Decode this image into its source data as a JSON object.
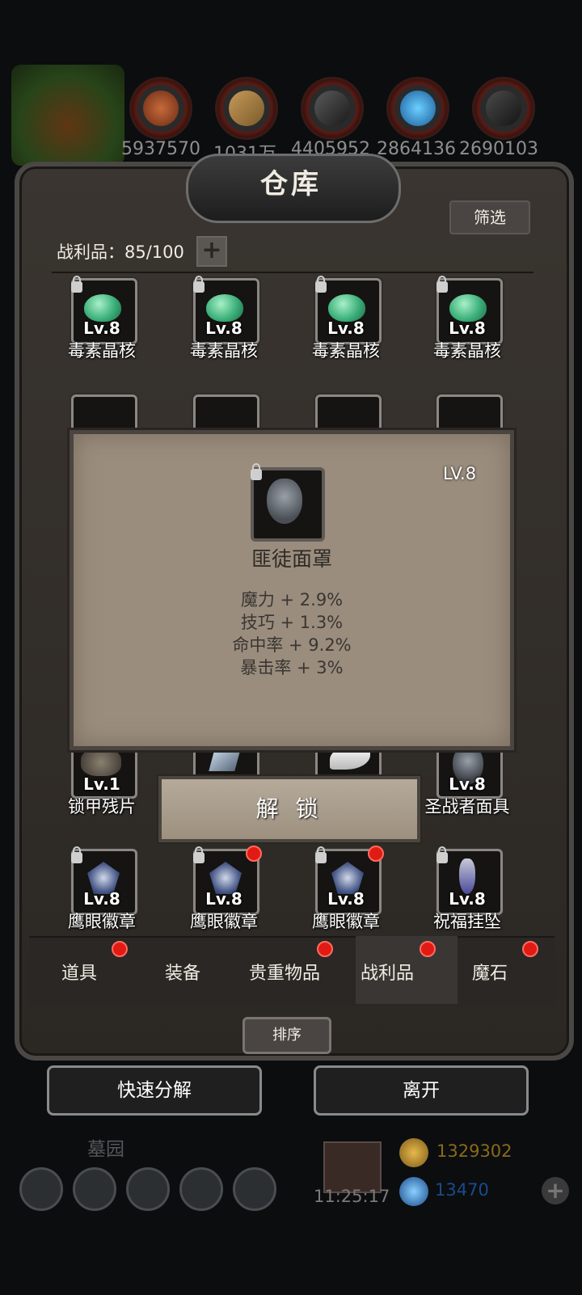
{
  "resources": [
    {
      "icon": "meat-icon",
      "value": "5937570"
    },
    {
      "icon": "wood-icon",
      "value": "1031万"
    },
    {
      "icon": "iron-icon",
      "value": "4405952"
    },
    {
      "icon": "crystal-icon",
      "value": "2864136"
    },
    {
      "icon": "stone-icon",
      "value": "2690103"
    }
  ],
  "warehouse": {
    "title": "仓库",
    "filter_label": "筛选",
    "counter_label": "战利品：85/100",
    "plus": "+"
  },
  "rows": [
    [
      {
        "name": "毒素晶核",
        "lv": "Lv.8",
        "icon": "green-gem-icon",
        "locked": true,
        "alert": false
      },
      {
        "name": "毒素晶核",
        "lv": "Lv.8",
        "icon": "green-gem-icon",
        "locked": true,
        "alert": false
      },
      {
        "name": "毒素晶核",
        "lv": "Lv.8",
        "icon": "green-gem-icon",
        "locked": true,
        "alert": false
      },
      {
        "name": "毒素晶核",
        "lv": "Lv.8",
        "icon": "green-gem-icon",
        "locked": true,
        "alert": false
      }
    ],
    [
      {
        "name": "锁甲残片",
        "lv": "Lv.1",
        "icon": "chain-armor-icon",
        "locked": false,
        "alert": false
      },
      {
        "name": "",
        "lv": "",
        "icon": "blade-icon",
        "locked": false,
        "alert": false
      },
      {
        "name": "",
        "lv": "",
        "icon": "wing-icon",
        "locked": false,
        "alert": false
      },
      {
        "name": "圣战者面具",
        "lv": "Lv.8",
        "icon": "mask-icon",
        "locked": false,
        "alert": false
      }
    ],
    [
      {
        "name": "鹰眼徽章",
        "lv": "Lv.8",
        "icon": "badge-icon",
        "locked": true,
        "alert": false
      },
      {
        "name": "鹰眼徽章",
        "lv": "Lv.8",
        "icon": "badge-icon",
        "locked": true,
        "alert": true
      },
      {
        "name": "鹰眼徽章",
        "lv": "Lv.8",
        "icon": "badge-icon",
        "locked": true,
        "alert": true
      },
      {
        "name": "祝福挂坠",
        "lv": "Lv.8",
        "icon": "pendant-icon",
        "locked": true,
        "alert": false
      }
    ]
  ],
  "tooltip": {
    "level": "LV.8",
    "name": "匪徒面罩",
    "stats": [
      "魔力 + 2.9%",
      "技巧 + 1.3%",
      "命中率 + 9.2%",
      "暴击率 + 3%"
    ],
    "unlock_label": "解 锁"
  },
  "tabs": [
    {
      "label": "道具",
      "alert": true
    },
    {
      "label": "装备",
      "alert": false
    },
    {
      "label": "贵重物品",
      "alert": true
    },
    {
      "label": "战利品",
      "alert": true,
      "active": true
    },
    {
      "label": "魔石",
      "alert": true
    }
  ],
  "sort_label": "排序",
  "quick_decompose_label": "快速分解",
  "leave_label": "离开",
  "footer": {
    "zone": "墓园",
    "clock": "11:25:17",
    "gold": "1329302",
    "gems": "13470",
    "add": "+"
  },
  "colors": {
    "accent_red": "#e11b14",
    "gold": "#8a6a1a",
    "gem_blue": "#1a4a8a"
  }
}
